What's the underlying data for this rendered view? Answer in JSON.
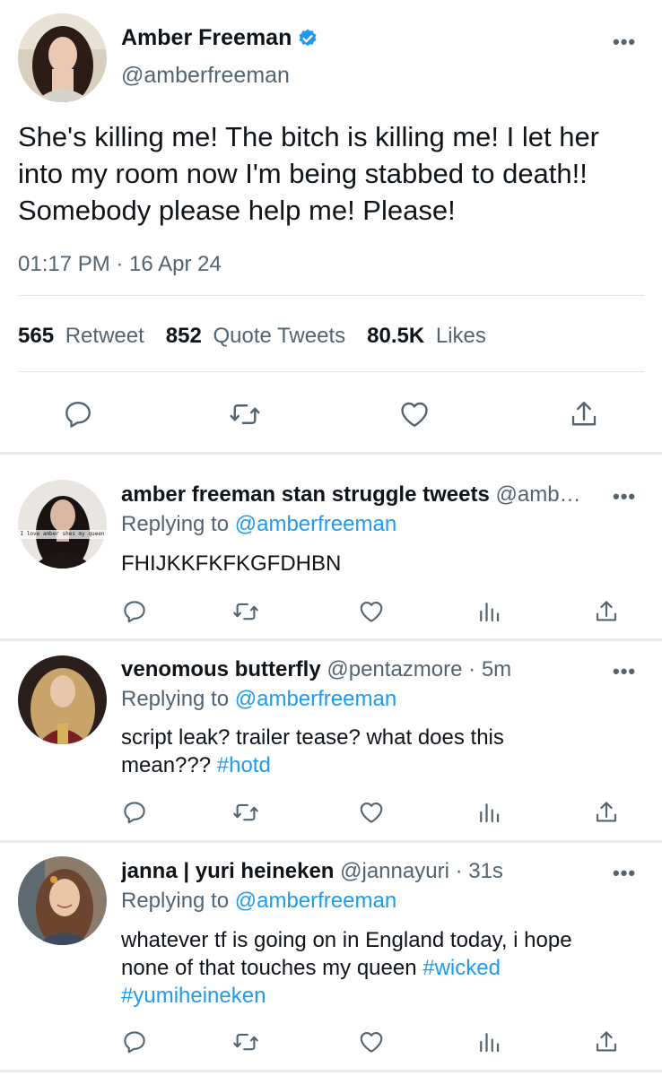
{
  "main_tweet": {
    "display_name": "Amber Freeman",
    "handle": "@amberfreeman",
    "text": "She's killing me! The bitch is killing me! I let her into my room now I'm being stabbed to death!! Somebody please help me! Please!",
    "timestamp": "01:17 PM · 16 Apr 24",
    "stats": [
      {
        "count": "565",
        "label": "Retweet"
      },
      {
        "count": "852",
        "label": "Quote Tweets"
      },
      {
        "count": "80.5K",
        "label": "Likes"
      }
    ],
    "action_icons": [
      "reply-icon",
      "retweet-icon",
      "like-icon",
      "share-icon"
    ]
  },
  "replies": [
    {
      "display_name": "amber freeman stan struggle tweets",
      "handle": "@amb…",
      "time": "",
      "replying_prefix": "Replying to",
      "replying_to": "@amberfreeman",
      "text_parts": [
        {
          "t": "FHIJKKFKFKGFDHBN",
          "link": false
        }
      ],
      "avatar_caption": "I love amber shes my queen"
    },
    {
      "display_name": "venomous butterfly",
      "handle": "@pentazmore",
      "time": " · 5m",
      "replying_prefix": "Replying to",
      "replying_to": "@amberfreeman",
      "text_parts": [
        {
          "t": "script leak? trailer tease? what does this",
          "link": false
        },
        {
          "t": "\n",
          "link": false
        },
        {
          "t": "mean??? ",
          "link": false
        },
        {
          "t": "#hotd",
          "link": true
        }
      ]
    },
    {
      "display_name": "janna | yuri heineken",
      "handle": "@jannayuri",
      "time": " · 31s",
      "replying_prefix": "Replying to",
      "replying_to": "@amberfreeman",
      "text_parts": [
        {
          "t": "whatever tf is going on in England today, i hope",
          "link": false
        },
        {
          "t": "\n",
          "link": false
        },
        {
          "t": "none of that touches my queen ",
          "link": false
        },
        {
          "t": "#wicked",
          "link": true
        },
        {
          "t": "\n",
          "link": false
        },
        {
          "t": "#yumiheineken",
          "link": true
        }
      ]
    }
  ],
  "colors": {
    "accent": "#1d9bf0",
    "secondary_text": "#536471",
    "divider": "#e6ecf0"
  }
}
